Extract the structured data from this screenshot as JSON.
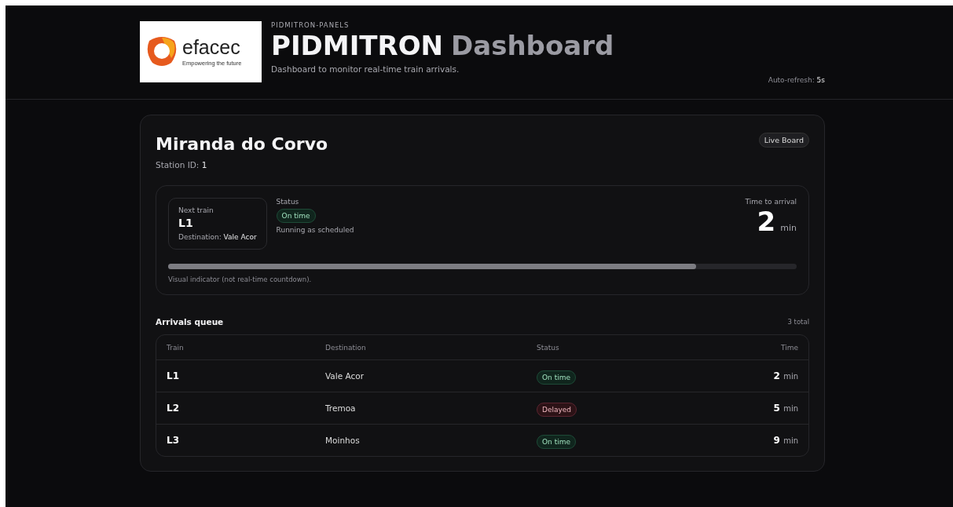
{
  "header": {
    "logo": {
      "name": "efacec",
      "tagline": "Empowering the future"
    },
    "eyebrow": "PIDMITRON-PANELS",
    "title_main": "PIDMITRON",
    "title_accent": "Dashboard",
    "subtitle": "Dashboard to monitor real-time train arrivals.",
    "refresh_label": "Auto-refresh:",
    "refresh_value": "5s"
  },
  "station": {
    "name": "Miranda do Corvo",
    "id_label": "Station ID:",
    "id_value": "1",
    "badge": "Live Board"
  },
  "next": {
    "label": "Next train",
    "train": "L1",
    "dest_label": "Destination:",
    "dest_value": "Vale Acor",
    "status_label": "Status",
    "status": {
      "kind": "on_time",
      "text": "On time"
    },
    "status_note": "Running as scheduled",
    "eta_label": "Time to arrival",
    "eta_value": "2",
    "eta_unit": "min",
    "level": 0.84,
    "indicator_note": "Visual indicator (not real-time countdown)."
  },
  "queue": {
    "title": "Arrivals queue",
    "count": "3 total",
    "columns": [
      "Train",
      "Destination",
      "Status",
      "Time"
    ],
    "rows": [
      {
        "train": "L1",
        "destination": "Vale Acor",
        "status": {
          "kind": "on_time",
          "text": "On time"
        },
        "time": "2",
        "unit": "min"
      },
      {
        "train": "L2",
        "destination": "Tremoa",
        "status": {
          "kind": "delayed",
          "text": "Delayed"
        },
        "time": "5",
        "unit": "min"
      },
      {
        "train": "L3",
        "destination": "Moinhos",
        "status": {
          "kind": "on_time",
          "text": "On time"
        },
        "time": "9",
        "unit": "min"
      }
    ]
  }
}
